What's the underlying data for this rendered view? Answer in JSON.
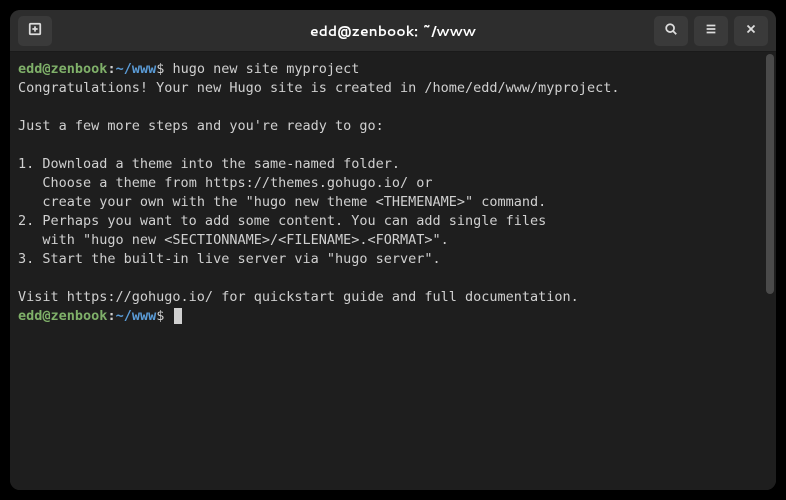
{
  "window": {
    "title": "edd@zenbook: ~/www"
  },
  "prompt": {
    "user": "edd",
    "at": "@",
    "host": "zenbook",
    "colon": ":",
    "path": "~/www",
    "dollar": "$ "
  },
  "session": {
    "command1": "hugo new site myproject",
    "out1": "Congratulations! Your new Hugo site is created in /home/edd/www/myproject.",
    "out2": "",
    "out3": "Just a few more steps and you're ready to go:",
    "out4": "",
    "out5": "1. Download a theme into the same-named folder.",
    "out6": "   Choose a theme from https://themes.gohugo.io/ or",
    "out7": "   create your own with the \"hugo new theme <THEMENAME>\" command.",
    "out8": "2. Perhaps you want to add some content. You can add single files",
    "out9": "   with \"hugo new <SECTIONNAME>/<FILENAME>.<FORMAT>\".",
    "out10": "3. Start the built-in live server via \"hugo server\".",
    "out11": "",
    "out12": "Visit https://gohugo.io/ for quickstart guide and full documentation."
  }
}
